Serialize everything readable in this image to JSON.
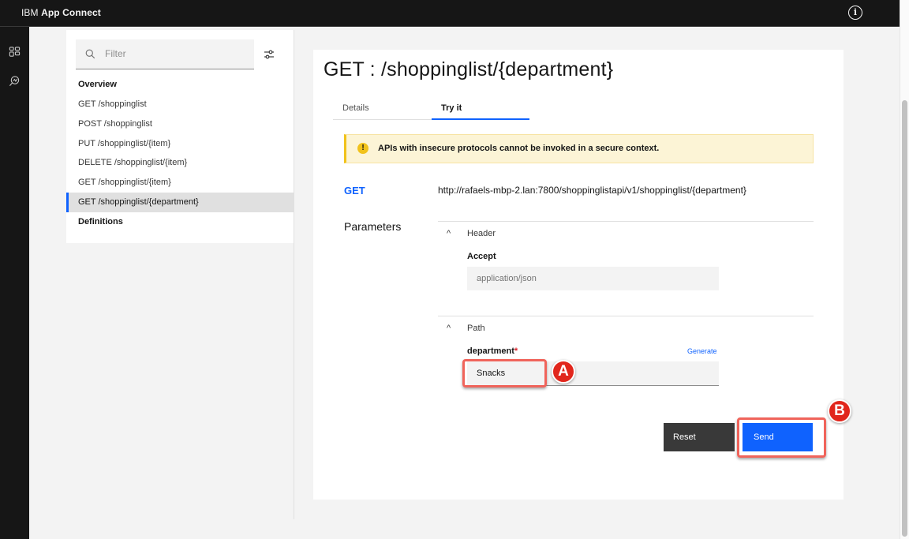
{
  "app": {
    "brand_prefix": "IBM",
    "brand_name": "App Connect",
    "info_icon": "i"
  },
  "rail": {
    "items": [
      {
        "icon": "dashboard-icon"
      },
      {
        "icon": "discovery-icon"
      }
    ]
  },
  "sidebar": {
    "filter_placeholder": "Filter",
    "items": [
      {
        "label": "Overview",
        "bold": true
      },
      {
        "label": "GET /shoppinglist"
      },
      {
        "label": "POST /shoppinglist"
      },
      {
        "label": "PUT /shoppinglist/{item}"
      },
      {
        "label": "DELETE /shoppinglist/{item}"
      },
      {
        "label": "GET /shoppinglist/{item}"
      },
      {
        "label": "GET /shoppinglist/{department}",
        "active": true
      },
      {
        "label": "Definitions",
        "bold": true
      }
    ]
  },
  "main": {
    "title": "GET : /shoppinglist/{department}",
    "tabs": [
      {
        "label": "Details"
      },
      {
        "label": "Try it",
        "active": true
      }
    ],
    "notice": {
      "icon": "!",
      "text": "APIs with insecure protocols cannot be invoked in a secure context."
    },
    "method": "GET",
    "url": "http://rafaels-mbp-2.lan:7800/shoppinglistapi/v1/shoppinglist/{department}",
    "parameters_label": "Parameters",
    "header_section": {
      "chevron": "^",
      "label": "Header",
      "field_label": "Accept",
      "field_placeholder": "application/json"
    },
    "path_section": {
      "chevron": "^",
      "label": "Path",
      "field_label": "department",
      "required_mark": "*",
      "generate_label": "Generate",
      "field_value": "Snacks"
    },
    "buttons": {
      "reset": "Reset",
      "send": "Send"
    }
  },
  "annotations": {
    "a": "A",
    "b": "B"
  },
  "colors": {
    "primary": "#0f62fe",
    "warning": "#f1c21b",
    "required": "#da1e28",
    "annotation": "#e1261c"
  }
}
